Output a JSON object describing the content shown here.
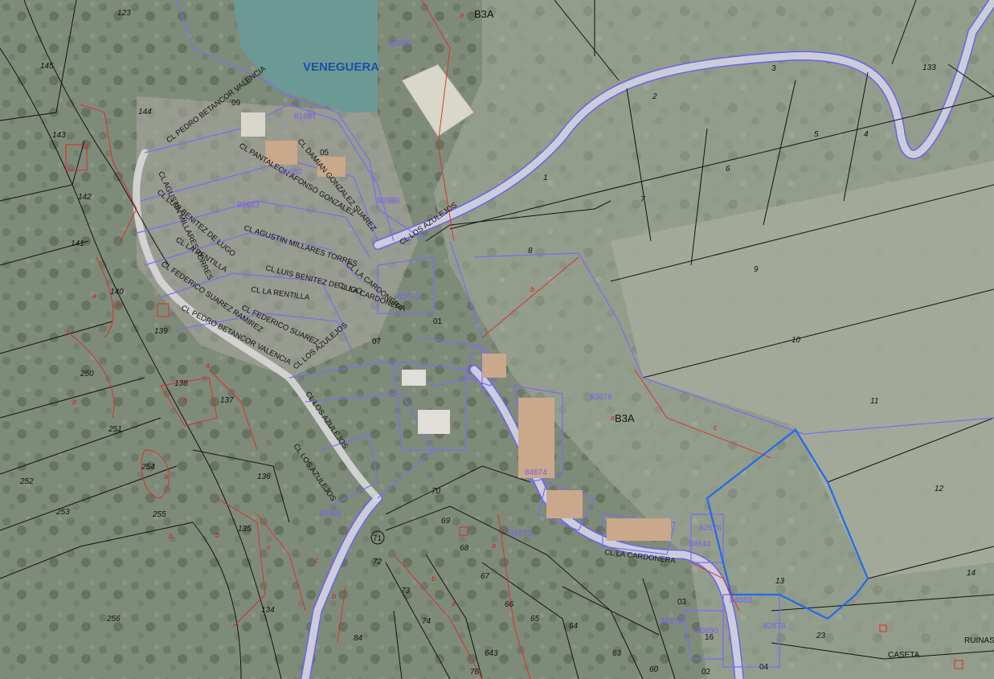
{
  "map": {
    "town_name": "VENEGUERA",
    "zones": [
      "B3A",
      "B3A"
    ],
    "landmarks": [
      "RUINAS",
      "CASETA"
    ],
    "streets": [
      "CL PEDRO BETANCOR VALENCIA",
      "CL PANTALEON AFONSO GONZALEZ",
      "CL DAMIAN GONZALEZ SUAREZ",
      "CL AGUSTIN MILLARES TORRES",
      "CL LUIS BENITEZ DE LUGO",
      "CL LA RENTILLA",
      "CL FEDERICO SUAREZ",
      "CL LOS AZULEJOS",
      "CL LOS AZULEJOS",
      "CL LA CARDONERA",
      "CL LA CARDONERA",
      "CL LOS AZULEJOS",
      "CL PEDRO BETANCOR VALENCIA",
      "CL AGUSTIN MILLARES TORRES",
      "CL LUIS BENITEZ DE LUGO",
      "CL LA RENTILLA",
      "CL FEDERICO SUAREZ RAMIREZ",
      "CL LOS AZULEJOS",
      "CL LOS AZULEJOS",
      "CL LA CARDONERA"
    ],
    "parcel_numbers": [
      "123",
      "145",
      "144",
      "143",
      "142",
      "141",
      "140",
      "139",
      "138",
      "137",
      "136",
      "135",
      "134",
      "250",
      "251",
      "252",
      "253",
      "254",
      "255",
      "256",
      "133",
      "3",
      "2",
      "1",
      "4",
      "5",
      "6",
      "7",
      "8",
      "9",
      "10",
      "11",
      "12",
      "13",
      "14",
      "23",
      "63",
      "64",
      "65",
      "66",
      "67",
      "68",
      "69",
      "70",
      "71",
      "72",
      "73",
      "74",
      "76",
      "84",
      "643",
      "60",
      "02",
      "04",
      "03",
      "16",
      "01",
      "09",
      "07",
      "05"
    ],
    "subparcel_letters": [
      "a",
      "b",
      "c"
    ],
    "cadastral_refs": [
      "82690",
      "81681",
      "81680",
      "80683",
      "82686",
      "83676",
      "84674",
      "83673",
      "81679",
      "81686",
      "84644",
      "82676",
      "80690",
      "82676",
      "81678",
      "84683"
    ]
  }
}
